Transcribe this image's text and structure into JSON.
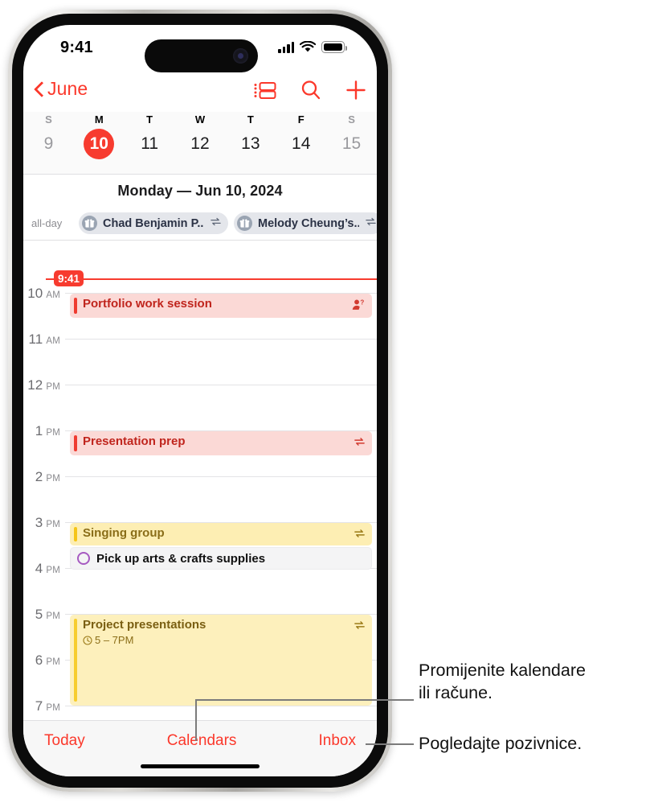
{
  "status_bar": {
    "time": "9:41",
    "signal_icon": "cellular-signal-icon",
    "wifi_icon": "wifi-icon",
    "battery_icon": "battery-icon"
  },
  "nav_bar": {
    "back_label": "June",
    "back_icon": "chevron-left-icon",
    "actions": [
      {
        "name": "list-view-icon",
        "label": "List view"
      },
      {
        "name": "search-icon",
        "label": "Search"
      },
      {
        "name": "add-event-icon",
        "label": "Add event"
      }
    ]
  },
  "week_strip": {
    "dow": [
      "S",
      "M",
      "T",
      "W",
      "T",
      "F",
      "S"
    ],
    "days": [
      {
        "num": "9",
        "state": "dim"
      },
      {
        "num": "10",
        "state": "today"
      },
      {
        "num": "11",
        "state": "normal"
      },
      {
        "num": "12",
        "state": "normal"
      },
      {
        "num": "13",
        "state": "normal"
      },
      {
        "num": "14",
        "state": "normal"
      },
      {
        "num": "15",
        "state": "dim"
      }
    ]
  },
  "day_header": {
    "title": "Monday — Jun 10, 2024"
  },
  "all_day": {
    "label": "all-day",
    "chips": [
      {
        "text": "Chad Benjamin P...",
        "icon": "gift-icon",
        "repeat_icon": "repeat-icon"
      },
      {
        "text": "Melody Cheung’s...",
        "icon": "gift-icon",
        "repeat_icon": "repeat-icon"
      }
    ]
  },
  "timeline": {
    "now_indicator": {
      "time": "9:41",
      "color": "#f73b2f"
    },
    "hours": [
      {
        "num": "10",
        "period": "AM"
      },
      {
        "num": "11",
        "period": "AM"
      },
      {
        "num": "12",
        "period": "PM"
      },
      {
        "num": "1",
        "period": "PM"
      },
      {
        "num": "2",
        "period": "PM"
      },
      {
        "num": "3",
        "period": "PM"
      },
      {
        "num": "4",
        "period": "PM"
      },
      {
        "num": "5",
        "period": "PM"
      },
      {
        "num": "6",
        "period": "PM"
      },
      {
        "num": "7",
        "period": "PM"
      }
    ],
    "events": [
      {
        "title": "Portfolio work session",
        "subtitle": "",
        "color": "red",
        "accent": "#ef3b30",
        "icon": "person-question-icon"
      },
      {
        "title": "Presentation prep",
        "subtitle": "",
        "color": "red",
        "accent": "#ef3b30",
        "icon": "repeat-icon"
      },
      {
        "title": "Singing group",
        "subtitle": "",
        "color": "yellow",
        "accent": "#f5c518",
        "icon": "repeat-icon"
      },
      {
        "title": "Project presentations",
        "subtitle": "5 – 7PM",
        "color": "yellowlight",
        "accent": "#f7cd2e",
        "icon": "repeat-icon",
        "sub_icon": "clock-icon"
      }
    ],
    "reminder": {
      "text": "Pick up arts & crafts supplies",
      "circle_color": "#a65ac1",
      "icon": "reminder-circle-icon"
    }
  },
  "tab_bar": {
    "items": [
      {
        "label": "Today",
        "name": "tab-today"
      },
      {
        "label": "Calendars",
        "name": "tab-calendars"
      },
      {
        "label": "Inbox",
        "name": "tab-inbox"
      }
    ]
  },
  "callouts": [
    {
      "line1": "Promijenite kalendare",
      "line2": "ili račune.",
      "target": "tab-calendars"
    },
    {
      "line1": "Pogledajte pozivnice.",
      "line2": "",
      "target": "tab-inbox"
    }
  ]
}
